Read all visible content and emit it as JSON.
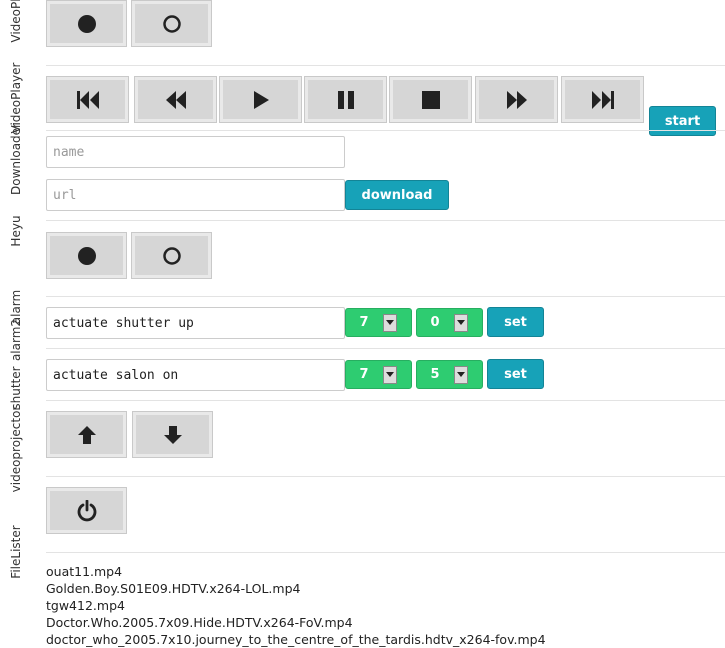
{
  "sections": {
    "videoplayerlight": {
      "label": "VideoPlayerlig"
    },
    "videoplayer": {
      "label": "VideoPlayer"
    },
    "downloader": {
      "label": "Downloader"
    },
    "heyu": {
      "label": "Heyu"
    },
    "alarm": {
      "label": "alarm"
    },
    "alarm2": {
      "label": "alarm2"
    },
    "shutter": {
      "label": "shutter"
    },
    "videoprojector": {
      "label": "videoprojector"
    },
    "filelister": {
      "label": "FileLister"
    }
  },
  "videoplayer": {
    "start_label": "start"
  },
  "downloader": {
    "name_placeholder": "name",
    "url_placeholder": "url",
    "download_label": "download"
  },
  "alarm": {
    "command": "actuate shutter up",
    "hour": "7",
    "minute": "0",
    "set_label": "set"
  },
  "alarm2": {
    "command": "actuate salon on",
    "hour": "7",
    "minute": "5",
    "set_label": "set"
  },
  "files": [
    "ouat11.mp4",
    "Golden.Boy.S01E09.HDTV.x264-LOL.mp4",
    "tgw412.mp4",
    "Doctor.Who.2005.7x09.Hide.HDTV.x264-FoV.mp4",
    "doctor_who_2005.7x10.journey_to_the_centre_of_the_tardis.hdtv_x264-fov.mp4"
  ],
  "colors": {
    "teal": "#17a2b8",
    "green": "#2ecc71",
    "gray_button": "#d6d6d6"
  },
  "icons": {
    "on": "record-icon",
    "off": "circle-icon",
    "first": "skip-first-icon",
    "rewind": "rewind-icon",
    "play": "play-icon",
    "pause": "pause-icon",
    "stop": "stop-icon",
    "forward": "fast-forward-icon",
    "last": "skip-last-icon",
    "up": "arrow-up-icon",
    "down": "arrow-down-icon",
    "power": "power-icon"
  }
}
